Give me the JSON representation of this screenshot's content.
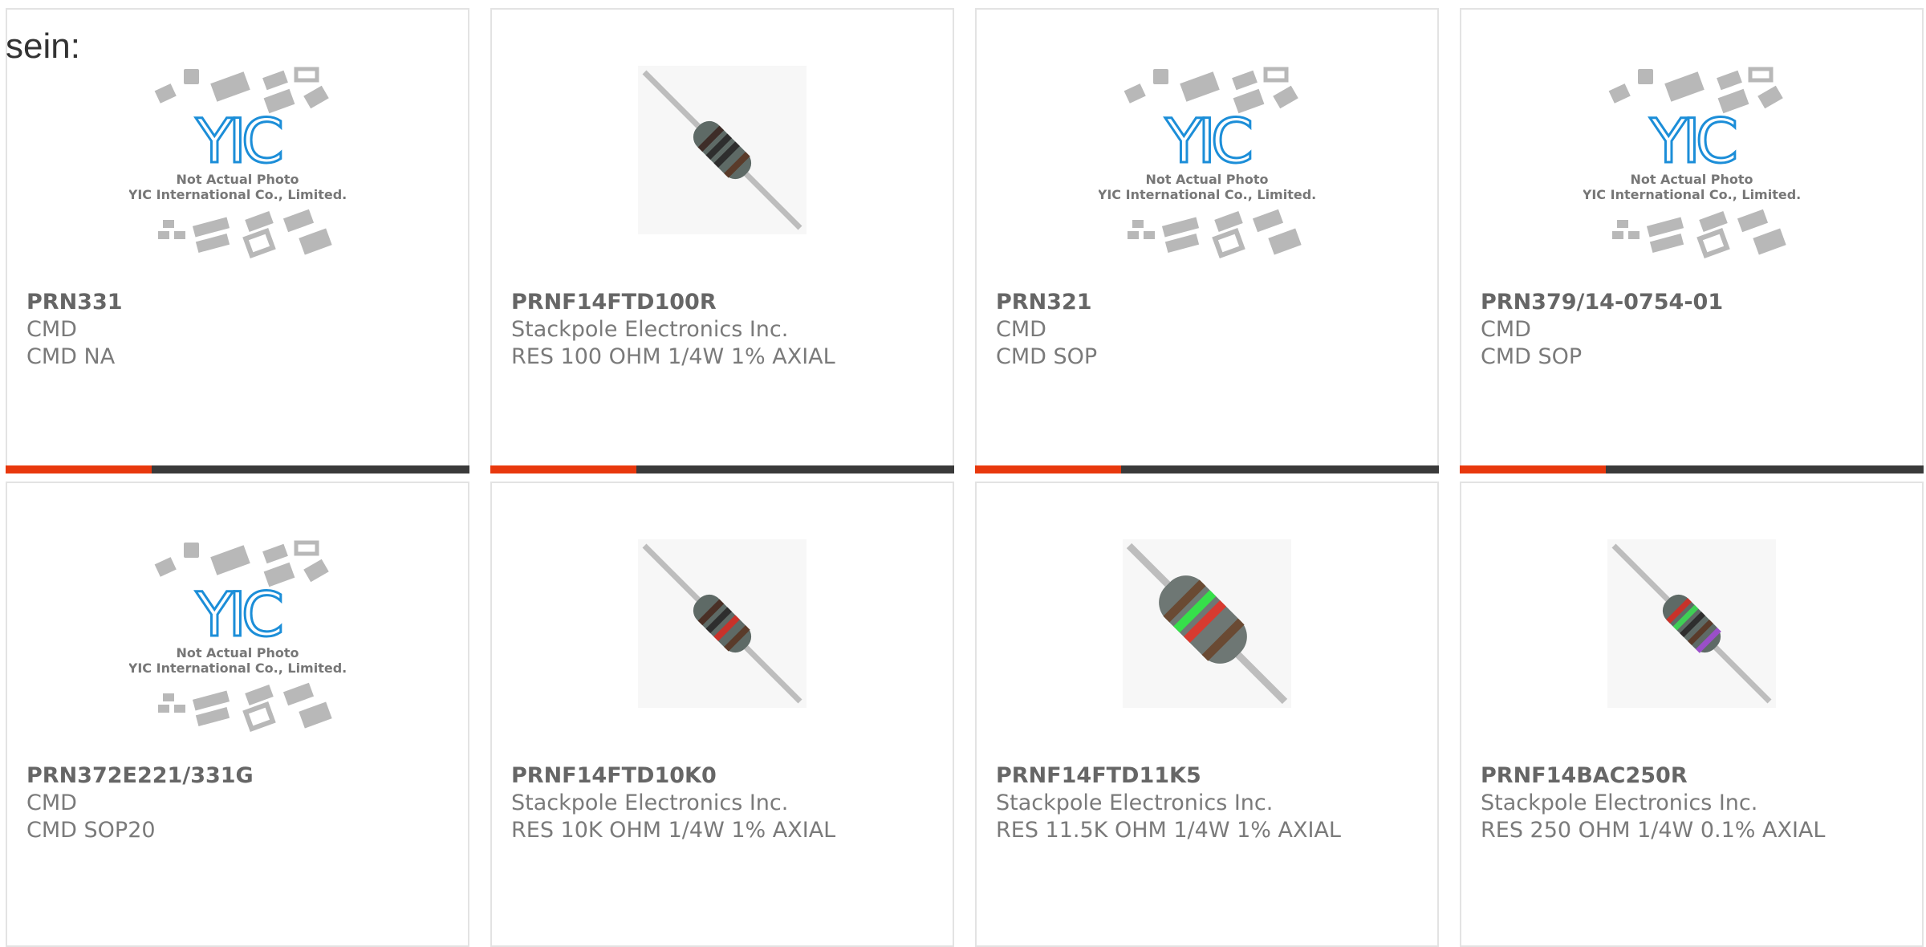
{
  "heading": "sein:",
  "colors": {
    "accent": "#e8380d",
    "bar": "#3a3a3a",
    "border": "#e3e3e3",
    "yic_blue": "#1c8ed8"
  },
  "placeholder": {
    "line1": "Not Actual Photo",
    "line2": "YIC International Co., Limited.",
    "logo": "YIC"
  },
  "products": [
    {
      "part": "PRN331",
      "maker": "CMD",
      "desc": "CMD NA",
      "image": "yic-placeholder"
    },
    {
      "part": "PRNF14FTD100R",
      "maker": "Stackpole Electronics Inc.",
      "desc": "RES 100 OHM 1/4W 1% AXIAL",
      "image": "resistor"
    },
    {
      "part": "PRN321",
      "maker": "CMD",
      "desc": "CMD SOP",
      "image": "yic-placeholder"
    },
    {
      "part": "PRN379/14-0754-01",
      "maker": "CMD",
      "desc": "CMD SOP",
      "image": "yic-placeholder"
    },
    {
      "part": "PRN372E221/331G",
      "maker": "CMD",
      "desc": "CMD SOP20",
      "image": "yic-placeholder"
    },
    {
      "part": "PRNF14FTD10K0",
      "maker": "Stackpole Electronics Inc.",
      "desc": "RES 10K OHM 1/4W 1% AXIAL",
      "image": "resistor"
    },
    {
      "part": "PRNF14FTD11K5",
      "maker": "Stackpole Electronics Inc.",
      "desc": "RES 11.5K OHM 1/4W 1% AXIAL",
      "image": "resistor-large"
    },
    {
      "part": "PRNF14BAC250R",
      "maker": "Stackpole Electronics Inc.",
      "desc": "RES 250 OHM 1/4W 0.1% AXIAL",
      "image": "resistor"
    }
  ]
}
